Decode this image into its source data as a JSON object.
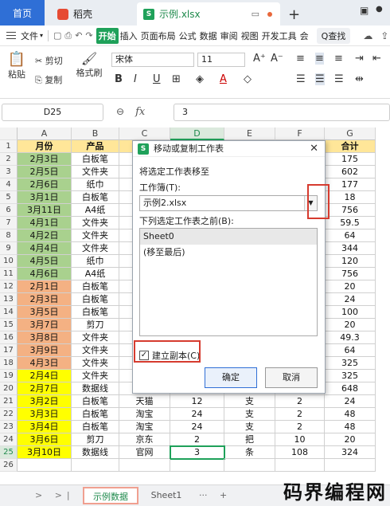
{
  "tabs": {
    "home": "首页",
    "daoke": "稻壳",
    "file": "示例.xlsx",
    "new_tab": "+"
  },
  "menubar": {
    "file_menu": "文件",
    "tabs": [
      "开始",
      "插入",
      "页面布局",
      "公式",
      "数据",
      "审阅",
      "视图",
      "开发工具",
      "会"
    ],
    "search": "Q查找"
  },
  "ribbon": {
    "paste": "粘贴",
    "cut": "剪切",
    "copy": "复制",
    "format_painter": "格式刷",
    "font": "宋体",
    "size": "11"
  },
  "formula_bar": {
    "name_box": "D25",
    "fx": "fx",
    "content": "3"
  },
  "sheet": {
    "columns": [
      "A",
      "B",
      "C",
      "D",
      "E",
      "F",
      "G"
    ],
    "rows": [
      [
        "月份",
        "产品",
        "",
        "",
        "",
        "",
        "合计"
      ],
      [
        "2月3日",
        "白板笔",
        "",
        "",
        "",
        "",
        "175"
      ],
      [
        "2月5日",
        "文件夹",
        "",
        "",
        "",
        "",
        "602"
      ],
      [
        "2月6日",
        "纸巾",
        "",
        "",
        "",
        "",
        "177"
      ],
      [
        "3月1日",
        "白板笔",
        "",
        "",
        "",
        "",
        "18"
      ],
      [
        "3月11日",
        "A4纸",
        "",
        "",
        "",
        "",
        "756"
      ],
      [
        "4月1日",
        "文件夹",
        "",
        "",
        "",
        "",
        "59.5"
      ],
      [
        "4月2日",
        "文件夹",
        "",
        "",
        "",
        "",
        "64"
      ],
      [
        "4月4日",
        "文件夹",
        "",
        "",
        "",
        "",
        "344"
      ],
      [
        "4月5日",
        "纸巾",
        "",
        "",
        "",
        "",
        "120"
      ],
      [
        "4月6日",
        "A4纸",
        "",
        "",
        "",
        "",
        "756"
      ],
      [
        "2月1日",
        "白板笔",
        "",
        "",
        "",
        "",
        "20"
      ],
      [
        "2月3日",
        "白板笔",
        "",
        "",
        "",
        "",
        "24"
      ],
      [
        "3月5日",
        "白板笔",
        "",
        "",
        "",
        "",
        "100"
      ],
      [
        "3月7日",
        "剪刀",
        "",
        "",
        "",
        "",
        "20"
      ],
      [
        "3月8日",
        "文件夹",
        "",
        "",
        "",
        "",
        "49.3"
      ],
      [
        "3月9日",
        "文件夹",
        "",
        "",
        "",
        "",
        "64"
      ],
      [
        "4月3日",
        "文件夹",
        "",
        "",
        "",
        "",
        "325"
      ],
      [
        "2月4日",
        "文件夹",
        "",
        "",
        "",
        "",
        "325"
      ],
      [
        "2月7日",
        "数据线",
        "",
        "",
        "",
        "",
        "648"
      ],
      [
        "3月2日",
        "白板笔",
        "天猫",
        "12",
        "支",
        "2",
        "24"
      ],
      [
        "3月3日",
        "白板笔",
        "淘宝",
        "24",
        "支",
        "2",
        "48"
      ],
      [
        "3月4日",
        "白板笔",
        "淘宝",
        "24",
        "支",
        "2",
        "48"
      ],
      [
        "3月6日",
        "剪刀",
        "京东",
        "2",
        "把",
        "10",
        "20"
      ],
      [
        "3月10日",
        "数据线",
        "官网",
        "3",
        "条",
        "108",
        "324"
      ]
    ]
  },
  "dialog": {
    "title": "移动或复制工作表",
    "line1": "将选定工作表移至",
    "workbook_label": "工作簿(T):",
    "workbook_value": "示例2.xlsx",
    "before_label": "下列选定工作表之前(B):",
    "list": [
      "Sheet0",
      "(移至最后)"
    ],
    "checkbox_label": "建立副本(C)",
    "checkbox_mark": "✓",
    "ok": "确定",
    "cancel": "取消"
  },
  "bottom": {
    "active_sheet": "示例数据",
    "sheet1": "Sheet1",
    "watermark": "码界编程网"
  },
  "colors": {
    "accent_green": "#1fa15a",
    "row_green": "#a9d18e",
    "row_orange": "#f4b183",
    "row_yellow": "#ffff00",
    "highlight_red": "#d63b2f"
  }
}
